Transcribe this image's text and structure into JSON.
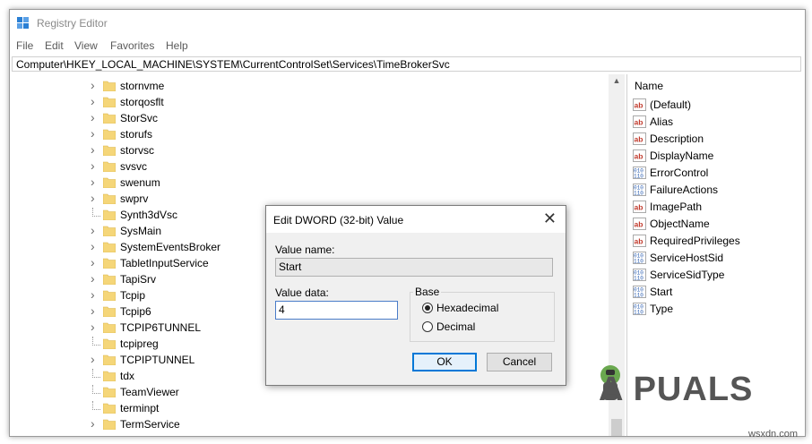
{
  "window": {
    "title": "Registry Editor"
  },
  "menu": [
    "File",
    "Edit",
    "View",
    "Favorites",
    "Help"
  ],
  "address": "Computer\\HKEY_LOCAL_MACHINE\\SYSTEM\\CurrentControlSet\\Services\\TimeBrokerSvc",
  "tree": [
    {
      "label": "stornvme",
      "expandable": true
    },
    {
      "label": "storqosflt",
      "expandable": true
    },
    {
      "label": "StorSvc",
      "expandable": true
    },
    {
      "label": "storufs",
      "expandable": true
    },
    {
      "label": "storvsc",
      "expandable": true
    },
    {
      "label": "svsvc",
      "expandable": true
    },
    {
      "label": "swenum",
      "expandable": true
    },
    {
      "label": "swprv",
      "expandable": true
    },
    {
      "label": "Synth3dVsc",
      "expandable": false
    },
    {
      "label": "SysMain",
      "expandable": true
    },
    {
      "label": "SystemEventsBroker",
      "expandable": true
    },
    {
      "label": "TabletInputService",
      "expandable": true
    },
    {
      "label": "TapiSrv",
      "expandable": true
    },
    {
      "label": "Tcpip",
      "expandable": true
    },
    {
      "label": "Tcpip6",
      "expandable": true
    },
    {
      "label": "TCPIP6TUNNEL",
      "expandable": true
    },
    {
      "label": "tcpipreg",
      "expandable": false
    },
    {
      "label": "TCPIPTUNNEL",
      "expandable": true
    },
    {
      "label": "tdx",
      "expandable": false
    },
    {
      "label": "TeamViewer",
      "expandable": false
    },
    {
      "label": "terminpt",
      "expandable": false
    },
    {
      "label": "TermService",
      "expandable": true
    }
  ],
  "values_header": "Name",
  "values": [
    {
      "name": "(Default)",
      "type": "string"
    },
    {
      "name": "Alias",
      "type": "string"
    },
    {
      "name": "Description",
      "type": "string"
    },
    {
      "name": "DisplayName",
      "type": "string"
    },
    {
      "name": "ErrorControl",
      "type": "binary"
    },
    {
      "name": "FailureActions",
      "type": "binary"
    },
    {
      "name": "ImagePath",
      "type": "string"
    },
    {
      "name": "ObjectName",
      "type": "string"
    },
    {
      "name": "RequiredPrivileges",
      "type": "string"
    },
    {
      "name": "ServiceHostSid",
      "type": "binary"
    },
    {
      "name": "ServiceSidType",
      "type": "binary"
    },
    {
      "name": "Start",
      "type": "binary"
    },
    {
      "name": "Type",
      "type": "binary"
    }
  ],
  "dialog": {
    "title": "Edit DWORD (32-bit) Value",
    "close": "✕",
    "value_name_label": "Value name:",
    "value_name": "Start",
    "value_data_label": "Value data:",
    "value_data": "4",
    "base_label": "Base",
    "hex_label": "Hexadecimal",
    "dec_label": "Decimal",
    "base_selected": "Hexadecimal",
    "ok_label": "OK",
    "cancel_label": "Cancel"
  },
  "watermark": {
    "logo_text": "A  PUALS",
    "site": "wsxdn.com"
  },
  "colors": {
    "folder": "#f5d679",
    "accent": "#0078d7",
    "string_icon": "#c0392b",
    "binary_icon": "#2a5db0"
  }
}
